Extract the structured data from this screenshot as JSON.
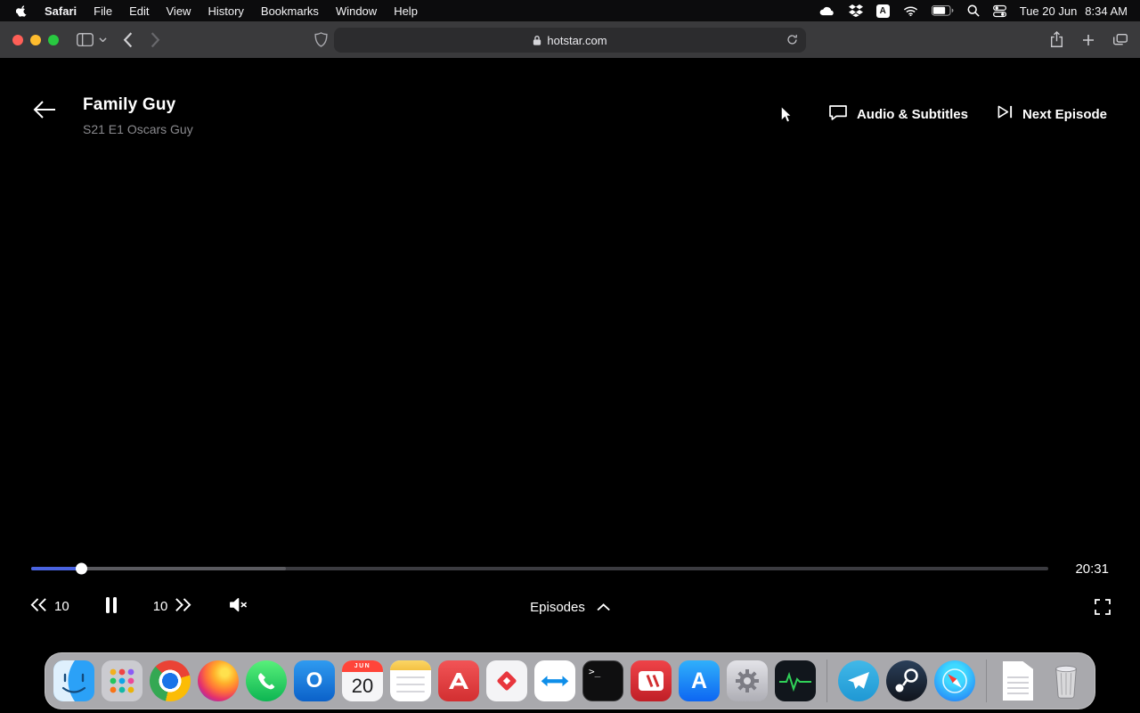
{
  "menu_bar": {
    "app_name": "Safari",
    "menus": [
      "File",
      "Edit",
      "View",
      "History",
      "Bookmarks",
      "Window",
      "Help"
    ],
    "status": {
      "input_letter": "A",
      "date": "Tue 20 Jun",
      "time": "8:34 AM"
    }
  },
  "browser": {
    "url": "hotstar.com"
  },
  "player": {
    "title": "Family Guy",
    "subtitle": "S21 E1 Oscars Guy",
    "audio_subtitles": "Audio & Subtitles",
    "next_episode": "Next Episode",
    "rewind_seconds": "10",
    "forward_seconds": "10",
    "episodes": "Episodes",
    "time_remaining": "20:31",
    "progress_percent": 5,
    "buffered_percent": 25,
    "accent_color": "#4a63e0"
  },
  "dock": {
    "calendar": {
      "month": "JUN",
      "day": "20"
    },
    "terminal_glyph": ">_",
    "app_store_letter": "A",
    "outlook_letter": "O",
    "icons": [
      "finder",
      "launchpad",
      "chrome",
      "firefox",
      "whatsapp",
      "outlook",
      "calendar",
      "notes",
      "red-app",
      "diamond-app",
      "teamviewer",
      "terminal",
      "parallels",
      "app-store",
      "system-settings",
      "activity-monitor",
      "telegram",
      "steam",
      "safari",
      "document",
      "trash"
    ]
  }
}
